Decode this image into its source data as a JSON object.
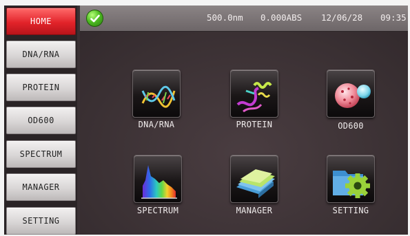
{
  "sidebar": {
    "items": [
      {
        "label": "HOME",
        "active": true
      },
      {
        "label": "DNA/RNA",
        "active": false
      },
      {
        "label": "PROTEIN",
        "active": false
      },
      {
        "label": "OD600",
        "active": false
      },
      {
        "label": "SPECTRUM",
        "active": false
      },
      {
        "label": "MANAGER",
        "active": false
      },
      {
        "label": "SETTING",
        "active": false
      }
    ]
  },
  "status": {
    "indicator_icon": "check-circle-icon",
    "wavelength": "500.0nm",
    "absorbance": "0.000ABS",
    "date": "12/06/28",
    "time": "09:35"
  },
  "apps": [
    {
      "label": "DNA/RNA",
      "icon": "dna-helix-icon"
    },
    {
      "label": "PROTEIN",
      "icon": "protein-ribbon-icon"
    },
    {
      "label": "OD600",
      "icon": "cell-culture-icon"
    },
    {
      "label": "SPECTRUM",
      "icon": "spectrum-graph-icon"
    },
    {
      "label": "MANAGER",
      "icon": "folder-stack-icon"
    },
    {
      "label": "SETTING",
      "icon": "gear-folder-icon"
    }
  ],
  "colors": {
    "active_nav": "#e2232a",
    "status_ok": "#4fbd23",
    "background": "#3a3134"
  }
}
